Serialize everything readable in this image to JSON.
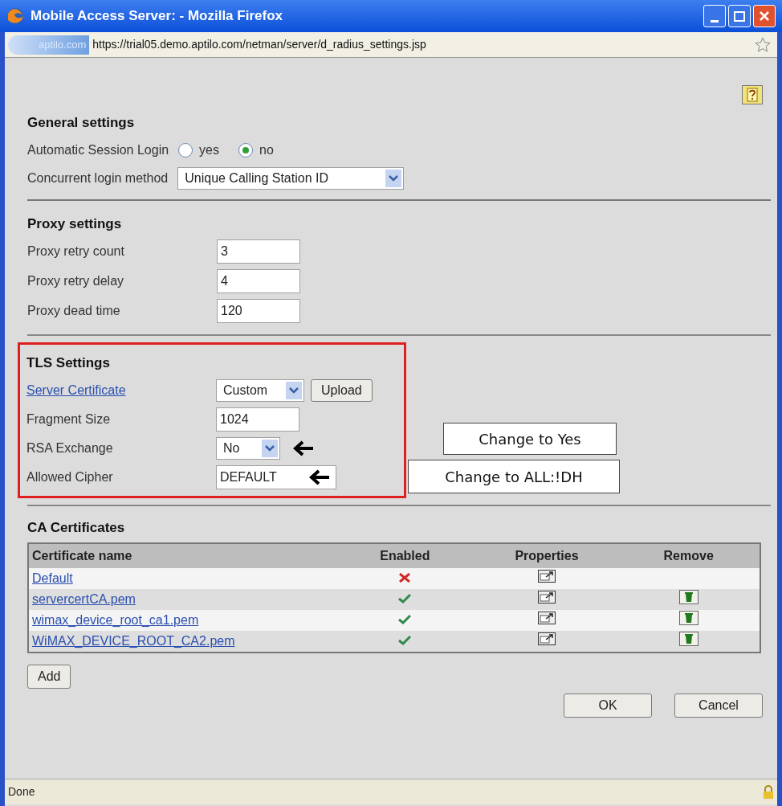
{
  "window": {
    "title": "Mobile Access Server: - Mozilla Firefox"
  },
  "address_bar": {
    "site": "aptilo.com",
    "url": "https://trial05.demo.aptilo.com/netman/server/d_radius_settings.jsp"
  },
  "general_settings": {
    "heading": "General settings",
    "session_login": {
      "label": "Automatic Session Login",
      "options": [
        {
          "label": "yes",
          "selected": false
        },
        {
          "label": "no",
          "selected": true
        }
      ]
    },
    "login_method": {
      "label": "Concurrent login method",
      "value": "Unique Calling Station ID"
    }
  },
  "proxy_settings": {
    "heading": "Proxy settings",
    "fields": [
      {
        "label": "Proxy retry count",
        "value": "3"
      },
      {
        "label": "Proxy retry delay",
        "value": "4"
      },
      {
        "label": "Proxy dead time",
        "value": "120"
      }
    ]
  },
  "tls_settings": {
    "heading": "TLS Settings",
    "highlighted": true,
    "rows": [
      {
        "kind": "select-upload",
        "label": "Server Certificate",
        "value": "Custom",
        "button": "Upload",
        "arrow": false
      },
      {
        "kind": "input",
        "label": "Fragment Size",
        "value": "1024",
        "arrow": false
      },
      {
        "kind": "select",
        "label": "RSA Exchange",
        "value": "No",
        "arrow": true
      },
      {
        "kind": "input",
        "label": "Allowed Cipher",
        "value": "DEFAULT",
        "arrow": true
      }
    ]
  },
  "annotations": [
    {
      "text": "Change to Yes"
    },
    {
      "text": "Change to ALL:!DH"
    }
  ],
  "ca_certificates": {
    "heading": "CA Certificates",
    "columns": [
      "Certificate name",
      "Enabled",
      "Properties",
      "Remove"
    ],
    "rows": [
      {
        "name": "Default",
        "enabled": false,
        "removable": false
      },
      {
        "name": "servercertCA.pem",
        "enabled": true,
        "removable": true
      },
      {
        "name": "wimax_device_root_ca1.pem",
        "enabled": true,
        "removable": true
      },
      {
        "name": "WiMAX_DEVICE_ROOT_CA2.pem",
        "enabled": true,
        "removable": true
      }
    ]
  },
  "add_button": "Add",
  "buttons": [
    "OK",
    "Cancel"
  ],
  "status_bar": {
    "text": "Done"
  }
}
